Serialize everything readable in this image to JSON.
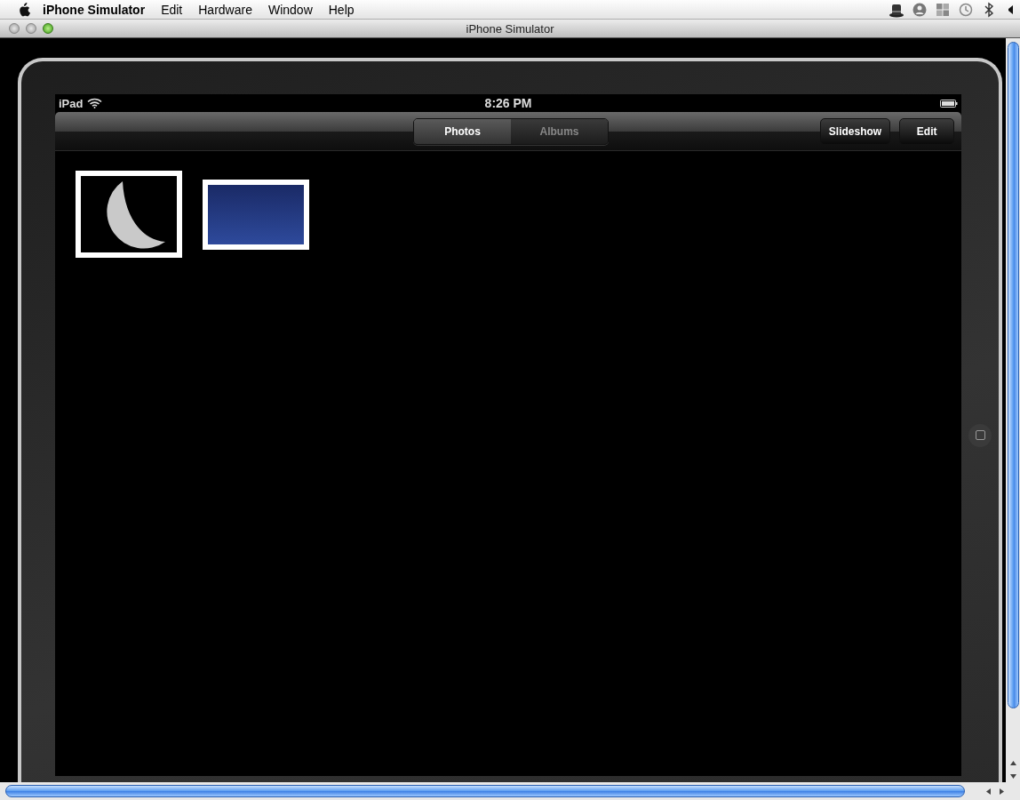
{
  "menu_bar": {
    "app": "iPhone Simulator",
    "items": [
      "Edit",
      "Hardware",
      "Window",
      "Help"
    ]
  },
  "window": {
    "title": "iPhone Simulator"
  },
  "status_bar": {
    "carrier": "iPad",
    "time": "8:26 PM"
  },
  "toolbar": {
    "segments": [
      {
        "label": "Photos",
        "selected": true
      },
      {
        "label": "Albums",
        "selected": false
      }
    ],
    "buttons": [
      "Slideshow",
      "Edit"
    ]
  },
  "photos": [
    {
      "kind": "moon"
    },
    {
      "kind": "night-sky"
    }
  ]
}
